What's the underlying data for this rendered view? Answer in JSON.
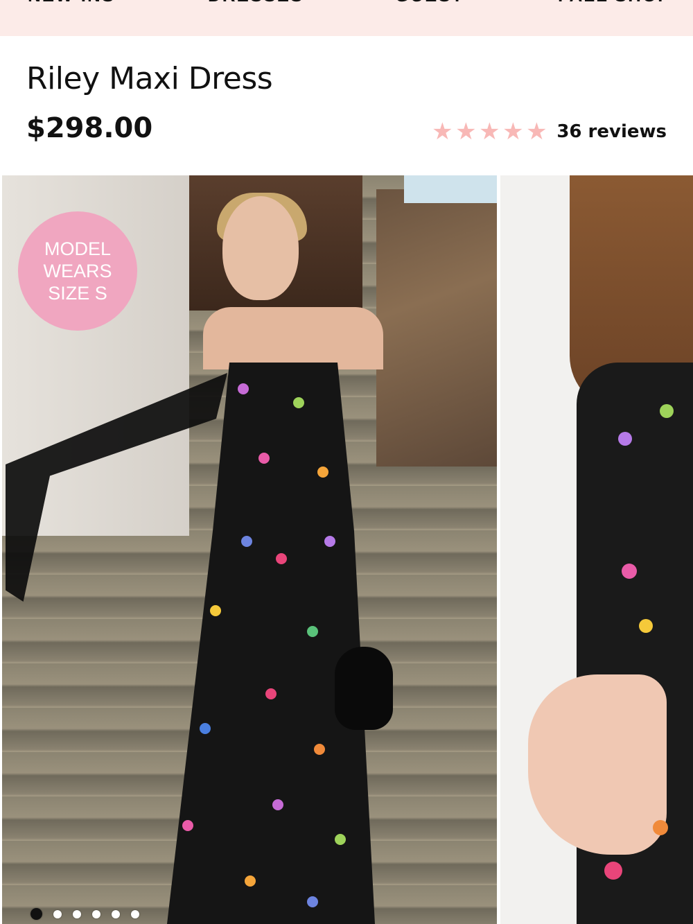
{
  "nav": {
    "items": [
      "NEW-INS",
      "DRESSES",
      "GUEST",
      "FALL SHOP"
    ]
  },
  "product": {
    "title": "Riley Maxi Dress",
    "price": "$298.00",
    "rating": 5,
    "rating_max": 5,
    "reviews_label": "36 reviews"
  },
  "gallery": {
    "badge_lines": [
      "MODEL",
      "WEARS",
      "SIZE S"
    ],
    "main_image": "model-on-stone-stairs-photo",
    "side_image": "dress-detail-photo",
    "dots_total": 6,
    "dots_active_index": 0
  },
  "colors": {
    "nav_bg": "#fcebe8",
    "star": "#f8b8b6",
    "badge": "#f0a6c0"
  }
}
